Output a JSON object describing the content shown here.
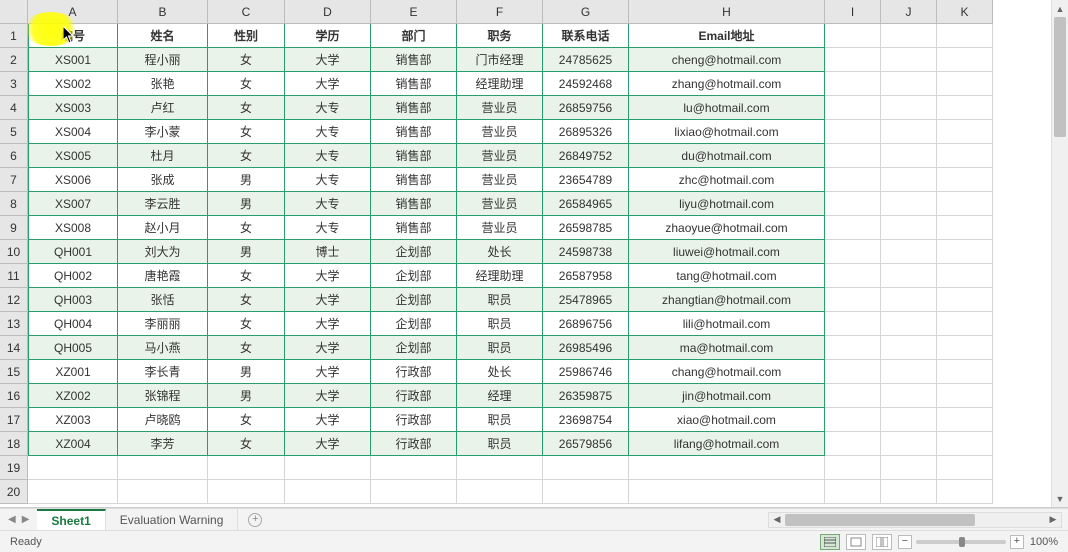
{
  "columns": [
    "A",
    "B",
    "C",
    "D",
    "E",
    "F",
    "G",
    "H",
    "I",
    "J",
    "K"
  ],
  "header_row": [
    "编号",
    "姓名",
    "性别",
    "学历",
    "部门",
    "职务",
    "联系电话",
    "Email地址"
  ],
  "rows": [
    [
      "XS001",
      "程小丽",
      "女",
      "大学",
      "销售部",
      "门市经理",
      "24785625",
      "cheng@hotmail.com"
    ],
    [
      "XS002",
      "张艳",
      "女",
      "大学",
      "销售部",
      "经理助理",
      "24592468",
      "zhang@hotmail.com"
    ],
    [
      "XS003",
      "卢红",
      "女",
      "大专",
      "销售部",
      "营业员",
      "26859756",
      "lu@hotmail.com"
    ],
    [
      "XS004",
      "李小蒙",
      "女",
      "大专",
      "销售部",
      "营业员",
      "26895326",
      "lixiao@hotmail.com"
    ],
    [
      "XS005",
      "杜月",
      "女",
      "大专",
      "销售部",
      "营业员",
      "26849752",
      "du@hotmail.com"
    ],
    [
      "XS006",
      "张成",
      "男",
      "大专",
      "销售部",
      "营业员",
      "23654789",
      "zhc@hotmail.com"
    ],
    [
      "XS007",
      "李云胜",
      "男",
      "大专",
      "销售部",
      "营业员",
      "26584965",
      "liyu@hotmail.com"
    ],
    [
      "XS008",
      "赵小月",
      "女",
      "大专",
      "销售部",
      "营业员",
      "26598785",
      "zhaoyue@hotmail.com"
    ],
    [
      "QH001",
      "刘大为",
      "男",
      "博士",
      "企划部",
      "处长",
      "24598738",
      "liuwei@hotmail.com"
    ],
    [
      "QH002",
      "唐艳霞",
      "女",
      "大学",
      "企划部",
      "经理助理",
      "26587958",
      "tang@hotmail.com"
    ],
    [
      "QH003",
      "张恬",
      "女",
      "大学",
      "企划部",
      "职员",
      "25478965",
      "zhangtian@hotmail.com"
    ],
    [
      "QH004",
      "李丽丽",
      "女",
      "大学",
      "企划部",
      "职员",
      "26896756",
      "lili@hotmail.com"
    ],
    [
      "QH005",
      "马小燕",
      "女",
      "大学",
      "企划部",
      "职员",
      "26985496",
      "ma@hotmail.com"
    ],
    [
      "XZ001",
      "李长青",
      "男",
      "大学",
      "行政部",
      "处长",
      "25986746",
      "chang@hotmail.com"
    ],
    [
      "XZ002",
      "张锦程",
      "男",
      "大学",
      "行政部",
      "经理",
      "26359875",
      "jin@hotmail.com"
    ],
    [
      "XZ003",
      "卢晓鸥",
      "女",
      "大学",
      "行政部",
      "职员",
      "23698754",
      "xiao@hotmail.com"
    ],
    [
      "XZ004",
      "李芳",
      "女",
      "大学",
      "行政部",
      "职员",
      "26579856",
      "lifang@hotmail.com"
    ]
  ],
  "empty_data_rows": 2,
  "total_data_rows": 20,
  "tabs": {
    "active": "Sheet1",
    "others": [
      "Evaluation Warning"
    ]
  },
  "status": {
    "ready": "Ready",
    "zoom": "100%"
  }
}
